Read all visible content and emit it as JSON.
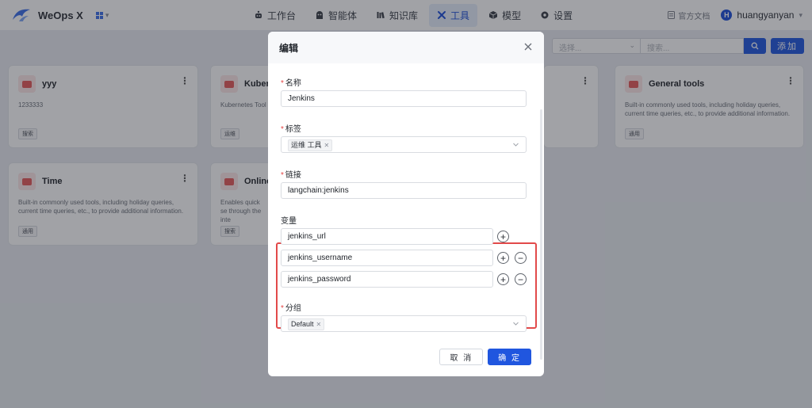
{
  "app": {
    "name": "WeOps X"
  },
  "nav": [
    {
      "label": "工作台",
      "icon": "robot-icon"
    },
    {
      "label": "智能体",
      "icon": "agent-icon"
    },
    {
      "label": "知识库",
      "icon": "library-icon"
    },
    {
      "label": "工具",
      "icon": "tools-icon",
      "active": true
    },
    {
      "label": "模型",
      "icon": "cube-icon"
    },
    {
      "label": "设置",
      "icon": "gear-icon"
    }
  ],
  "header": {
    "docs_label": "官方文档",
    "user_initial": "H",
    "username": "huangyanyan"
  },
  "toolbar": {
    "select_placeholder": "选择...",
    "search_placeholder": "搜索...",
    "add_label": "添加"
  },
  "cards": [
    {
      "title": "yyy",
      "desc": "1233333",
      "tag": "搜索"
    },
    {
      "title": "Kubern",
      "desc": "Kubernetes Tool",
      "tag": "运维"
    },
    {
      "title": "General tools",
      "desc": "Built-in commonly used tools, including holiday queries, current time queries, etc., to provide additional information.",
      "tag": "通用"
    },
    {
      "title": "Time",
      "desc": "Built-in commonly used tools, including holiday queries, current time queries, etc., to provide additional information.",
      "tag": "通用"
    },
    {
      "title": "Online",
      "desc": "Enables quick se through the inte",
      "tag": "搜索"
    }
  ],
  "modal": {
    "title": "编辑",
    "name_label": "名称",
    "name_value": "Jenkins",
    "tags_label": "标签",
    "tags": [
      "运维 工具"
    ],
    "link_label": "链接",
    "link_value": "langchain:jenkins",
    "vars_label": "变量",
    "variables": [
      "jenkins_url",
      "jenkins_username",
      "jenkins_password"
    ],
    "group_label": "分组",
    "groups": [
      "Default"
    ],
    "cancel_label": "取 消",
    "ok_label": "确 定"
  },
  "colors": {
    "primary": "#2056df",
    "highlight": "#e24a4a",
    "required": "#e54545"
  }
}
